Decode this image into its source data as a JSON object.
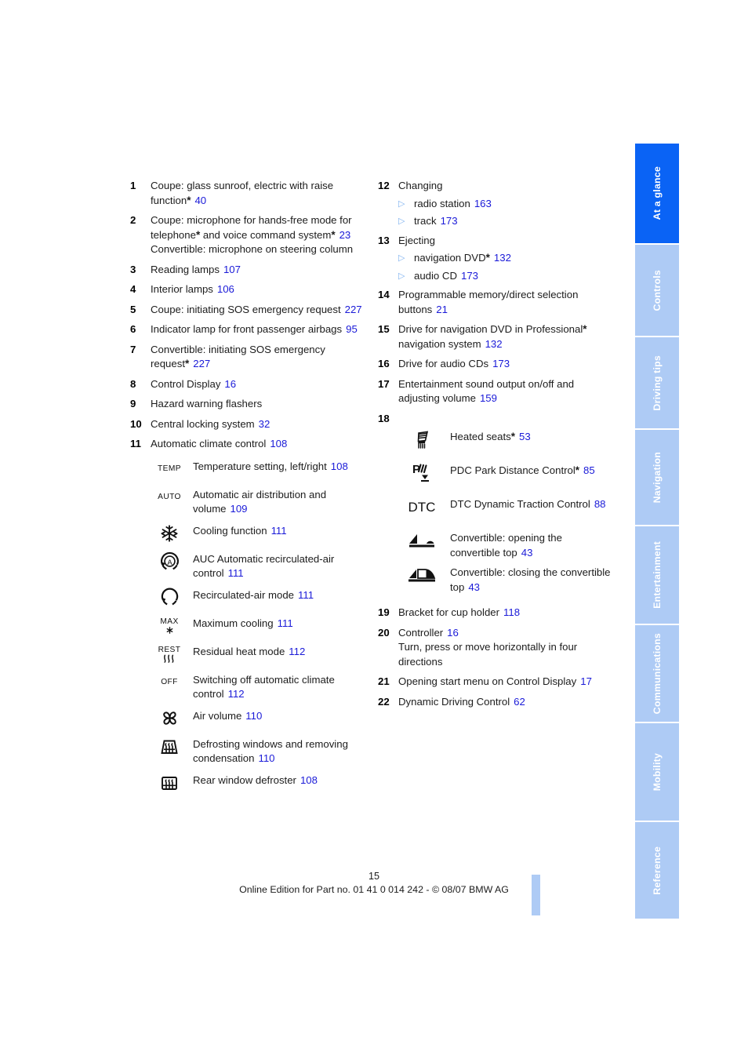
{
  "page": {
    "number": "15",
    "footer_text": "Online Edition for Part no. 01 41 0 014 242 - © 08/07 BMW AG"
  },
  "colors": {
    "link": "#1a1ad8",
    "tab_active": "#0a63f5",
    "tab_inactive": "#aecbf5",
    "bullet": "#7fb2f0"
  },
  "sidebar": {
    "tabs": [
      {
        "label": "At a glance",
        "active": true
      },
      {
        "label": "Controls",
        "active": false
      },
      {
        "label": "Driving tips",
        "active": false
      },
      {
        "label": "Navigation",
        "active": false
      },
      {
        "label": "Entertainment",
        "active": false
      },
      {
        "label": "Communications",
        "active": false
      },
      {
        "label": "Mobility",
        "active": false
      },
      {
        "label": "Reference",
        "active": false
      }
    ]
  },
  "left_column": {
    "items": [
      {
        "num": "1",
        "text": "Coupe: glass sunroof, electric with raise function",
        "asterisk": true,
        "page": "40"
      },
      {
        "num": "2",
        "text_a": "Coupe: microphone for hands-free mode for telephone",
        "text_b": " and voice command system",
        "page": "23",
        "text_c": "Convertible: microphone on steering column"
      },
      {
        "num": "3",
        "text": "Reading lamps",
        "page": "107"
      },
      {
        "num": "4",
        "text": "Interior lamps",
        "page": "106"
      },
      {
        "num": "5",
        "text": "Coupe: initiating SOS emergency request",
        "page": "227"
      },
      {
        "num": "6",
        "text": "Indicator lamp for front passenger airbags",
        "page": "95"
      },
      {
        "num": "7",
        "text": "Convertible: initiating SOS emergency request",
        "asterisk": true,
        "page": "227"
      },
      {
        "num": "8",
        "text": "Control Display",
        "page": "16"
      },
      {
        "num": "9",
        "text": "Hazard warning flashers",
        "page": ""
      },
      {
        "num": "10",
        "text": "Central locking system",
        "page": "32"
      },
      {
        "num": "11",
        "text": "Automatic climate control",
        "page": "108"
      }
    ],
    "climate_icons": [
      {
        "icon": "temp-text-icon",
        "glyph": "TEMP",
        "label": "Temperature setting, left/right",
        "page": "108"
      },
      {
        "icon": "auto-text-icon",
        "glyph": "AUTO",
        "label": "Automatic air distribution and volume",
        "page": "109"
      },
      {
        "icon": "snowflake-icon",
        "glyph": "",
        "label": "Cooling function",
        "page": "111"
      },
      {
        "icon": "auc-recirculated-air-icon",
        "glyph": "",
        "label": "AUC Automatic recirculated-air control",
        "page": "111"
      },
      {
        "icon": "recirculated-air-mode-icon",
        "glyph": "",
        "label": "Recirculated-air mode",
        "page": "111"
      },
      {
        "icon": "max-cooling-icon",
        "glyph": "MAX",
        "label": "Maximum cooling",
        "page": "111"
      },
      {
        "icon": "residual-heat-icon",
        "glyph": "REST",
        "label": "Residual heat mode",
        "page": "112"
      },
      {
        "icon": "off-text-icon",
        "glyph": "OFF",
        "label": "Switching off automatic climate control",
        "page": "112"
      },
      {
        "icon": "fan-air-volume-icon",
        "glyph": "",
        "label": "Air volume",
        "page": "110"
      },
      {
        "icon": "windshield-defrost-icon",
        "glyph": "",
        "label": "Defrosting windows and removing condensation",
        "page": "110"
      },
      {
        "icon": "rear-window-defroster-icon",
        "glyph": "",
        "label": "Rear window defroster",
        "page": "108"
      }
    ]
  },
  "right_column": {
    "items": [
      {
        "num": "12",
        "text": "Changing",
        "page": "",
        "subs": [
          {
            "text": "radio station",
            "page": "163"
          },
          {
            "text": "track",
            "page": "173"
          }
        ]
      },
      {
        "num": "13",
        "text": "Ejecting",
        "page": "",
        "subs": [
          {
            "text": "navigation DVD",
            "asterisk": true,
            "page": "132"
          },
          {
            "text": "audio CD",
            "page": "173"
          }
        ]
      },
      {
        "num": "14",
        "text": "Programmable memory/direct selection buttons",
        "page": "21"
      },
      {
        "num": "15",
        "text_a": "Drive for navigation DVD in Professional",
        "asterisk": true,
        "text_b": "navigation system",
        "page": "132"
      },
      {
        "num": "16",
        "text": "Drive for audio CDs",
        "page": "173"
      },
      {
        "num": "17",
        "text": "Entertainment sound output on/off and adjusting volume",
        "page": "159"
      },
      {
        "num": "18",
        "text": "",
        "page": ""
      }
    ],
    "console_icons": [
      {
        "icon": "heated-seats-icon",
        "glyph": "",
        "label": "Heated seats",
        "asterisk": true,
        "page": "53"
      },
      {
        "icon": "pdc-park-distance-icon",
        "glyph": "",
        "label": "PDC Park Distance Control",
        "asterisk": true,
        "page": "85"
      },
      {
        "icon": "dtc-text-icon",
        "glyph": "DTC",
        "label": "DTC Dynamic Traction Control",
        "page": "88"
      },
      {
        "icon": "convertible-top-open-icon",
        "glyph": "",
        "label": "Convertible: opening the convertible top",
        "page": "43"
      },
      {
        "icon": "convertible-top-close-icon",
        "glyph": "",
        "label": "Convertible: closing the convertible top",
        "page": "43"
      }
    ],
    "items_tail": [
      {
        "num": "19",
        "text": "Bracket for cup holder",
        "page": "118"
      },
      {
        "num": "20",
        "text": "Controller",
        "page": "16",
        "text_c": "Turn, press or move horizontally in four directions"
      },
      {
        "num": "21",
        "text": "Opening start menu on Control Display",
        "page": "17"
      },
      {
        "num": "22",
        "text": "Dynamic Driving Control",
        "page": "62"
      }
    ]
  }
}
